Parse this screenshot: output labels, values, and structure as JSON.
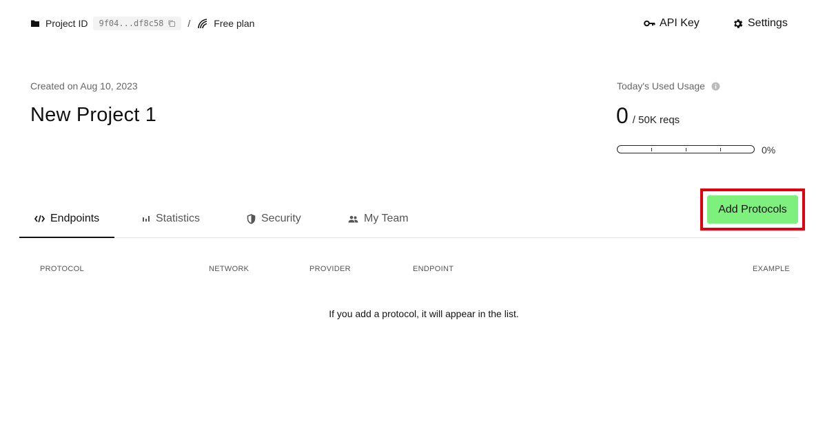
{
  "breadcrumb": {
    "project_id_label": "Project ID",
    "project_id_value": "9f04...df8c58",
    "separator": "/",
    "plan_label": "Free plan"
  },
  "header_actions": {
    "api_key_label": "API Key",
    "settings_label": "Settings"
  },
  "project": {
    "created_text": "Created on Aug 10, 2023",
    "title": "New Project 1"
  },
  "usage": {
    "label": "Today's Used Usage",
    "used": "0",
    "limit": "/ 50K reqs",
    "percent_text": "0%",
    "percent_value": 0
  },
  "tabs": [
    {
      "label": "Endpoints",
      "icon": "code-icon",
      "active": true
    },
    {
      "label": "Statistics",
      "icon": "bar-chart-icon",
      "active": false
    },
    {
      "label": "Security",
      "icon": "shield-icon",
      "active": false
    },
    {
      "label": "My Team",
      "icon": "team-icon",
      "active": false
    }
  ],
  "add_button_label": "Add Protocols",
  "table": {
    "columns": [
      "PROTOCOL",
      "NETWORK",
      "PROVIDER",
      "ENDPOINT",
      "EXAMPLE"
    ],
    "empty_message": "If you add a protocol, it will appear in the list."
  },
  "colors": {
    "accent_green": "#7ef07e",
    "highlight_red": "#e0000f"
  }
}
